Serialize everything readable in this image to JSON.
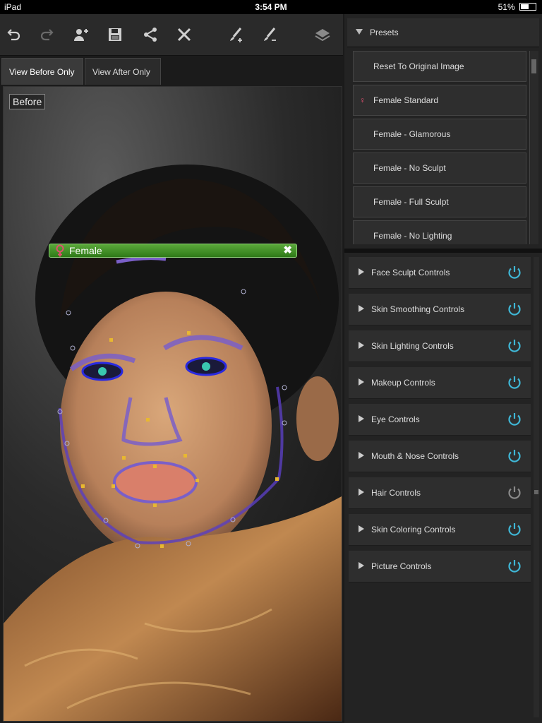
{
  "status": {
    "device": "iPad",
    "time": "3:54 PM",
    "battery": "51%",
    "battery_level": 0.51
  },
  "toolbar": {
    "buttons": [
      {
        "name": "undo-button",
        "icon": "undo-icon"
      },
      {
        "name": "redo-button",
        "icon": "redo-icon"
      },
      {
        "name": "add-face-button",
        "icon": "add-person-icon"
      },
      {
        "name": "save-button",
        "icon": "save-icon"
      },
      {
        "name": "share-button",
        "icon": "share-icon"
      },
      {
        "name": "close-button",
        "icon": "close-icon"
      },
      {
        "name": "brush-add-button",
        "icon": "brush-plus-icon"
      },
      {
        "name": "brush-erase-button",
        "icon": "brush-minus-icon"
      },
      {
        "name": "layers-button",
        "icon": "layers-icon"
      }
    ]
  },
  "tabs": {
    "before": "View Before Only",
    "after": "View After Only"
  },
  "canvas": {
    "before_label": "Before",
    "face_label": "Female",
    "face_close": "✖"
  },
  "presets": {
    "title": "Presets",
    "items": [
      {
        "label": "Reset To Original Image"
      },
      {
        "label": "Female Standard",
        "icon": "female-icon"
      },
      {
        "label": "Female - Glamorous"
      },
      {
        "label": "Female - No Sculpt"
      },
      {
        "label": "Female - Full Sculpt"
      },
      {
        "label": "Female - No Lighting"
      }
    ]
  },
  "controls": [
    {
      "label": "Face Sculpt Controls",
      "on": true
    },
    {
      "label": "Skin Smoothing Controls",
      "on": true
    },
    {
      "label": "Skin Lighting Controls",
      "on": true
    },
    {
      "label": "Makeup Controls",
      "on": true
    },
    {
      "label": "Eye Controls",
      "on": true
    },
    {
      "label": "Mouth & Nose Controls",
      "on": true
    },
    {
      "label": "Hair Controls",
      "on": false
    },
    {
      "label": "Skin Coloring Controls",
      "on": true
    },
    {
      "label": "Picture Controls",
      "on": true
    }
  ],
  "colors": {
    "power_on": "#3fb7d6",
    "power_off": "#8a8a8a",
    "face_tag": "#3f9a22",
    "female_icon": "#e05070"
  }
}
